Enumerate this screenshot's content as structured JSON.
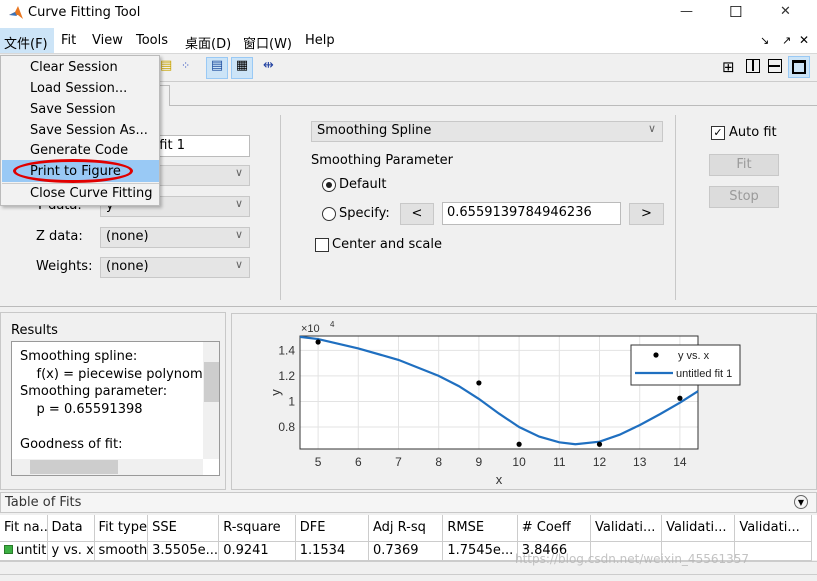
{
  "window": {
    "title": "Curve Fitting Tool",
    "minimize": "—",
    "maximize": "☐",
    "close": "✕"
  },
  "menubar": [
    "文件(F)",
    "Fit",
    "View",
    "Tools",
    "桌面(D)",
    "窗口(W)",
    "Help"
  ],
  "file_menu": [
    "Clear Session",
    "Load Session...",
    "Save Session",
    "Save Session As...",
    "Generate Code",
    "Print to Figure",
    "Close Curve Fitting"
  ],
  "file_menu_highlighted": "Print to Figure",
  "highlight_color": "#99c9f5",
  "annotation_color": "#e00000",
  "fit_form": {
    "fit_name": "untitled fit 1",
    "y_label": "Y data:",
    "y_value": "y",
    "z_label": "Z data:",
    "z_value": "(none)",
    "w_label": "Weights:",
    "w_value": "(none)"
  },
  "fit_options": {
    "fit_type": "Smoothing Spline",
    "param_heading": "Smoothing Parameter",
    "default_label": "Default",
    "specify_label": "Specify:",
    "dec": "<",
    "inc": ">",
    "param_value": "0.6559139784946236",
    "center_scale": "Center and scale",
    "default_selected": true,
    "center_checked": false
  },
  "actions": {
    "auto_fit": "Auto fit",
    "auto_checked": true,
    "fit": "Fit",
    "stop": "Stop"
  },
  "results": {
    "title": "Results",
    "lines": [
      "Smoothing spline:",
      "    f(x) = piecewise polynom",
      "Smoothing parameter:",
      "    p = 0.65591398",
      "",
      "Goodness of fit:"
    ]
  },
  "chart_data": {
    "type": "line",
    "xlabel": "x",
    "ylabel": "y",
    "y_exponent": "×10",
    "y_exponent_power": "4",
    "xlim": [
      4.55,
      14.45
    ],
    "ylim": [
      6280,
      15120
    ],
    "grid": true,
    "legend_position": "top-right",
    "xticks": [
      5,
      6,
      7,
      8,
      9,
      10,
      11,
      12,
      13,
      14
    ],
    "yticks": [
      0.8,
      1,
      1.2,
      1.4
    ],
    "series": [
      {
        "name": "y vs. x",
        "kind": "scatter",
        "color": "#000000",
        "x": [
          5,
          9,
          10,
          12,
          14
        ],
        "y": [
          14650,
          11450,
          6650,
          6650,
          10250
        ]
      },
      {
        "name": "untitled fit 1",
        "kind": "line",
        "color": "#1f6fc0",
        "x": [
          4.55,
          5,
          6,
          7,
          8,
          8.5,
          9,
          9.5,
          10,
          10.5,
          11,
          11.4,
          12,
          12.5,
          13,
          13.5,
          14,
          14.45
        ],
        "y": [
          15050,
          14880,
          14150,
          13250,
          12000,
          11200,
          10200,
          9050,
          8000,
          7250,
          6800,
          6650,
          6850,
          7400,
          8150,
          9000,
          9900,
          10800
        ]
      }
    ]
  },
  "table": {
    "title": "Table of Fits",
    "columns": [
      "Fit na... ▲",
      "Data",
      "Fit type",
      "SSE",
      "R-square",
      "DFE",
      "Adj R-sq",
      "RMSE",
      "# Coeff",
      "Validati...",
      "Validati...",
      "Validati..."
    ],
    "rows": [
      [
        "untitle...",
        "y vs. x",
        "smoothi...",
        "3.5505e...",
        "0.9241",
        "1.1534",
        "0.7369",
        "1.7545e...",
        "3.8466",
        "",
        "",
        ""
      ]
    ]
  },
  "watermark": "https://blog.csdn.net/weixin_45561357"
}
